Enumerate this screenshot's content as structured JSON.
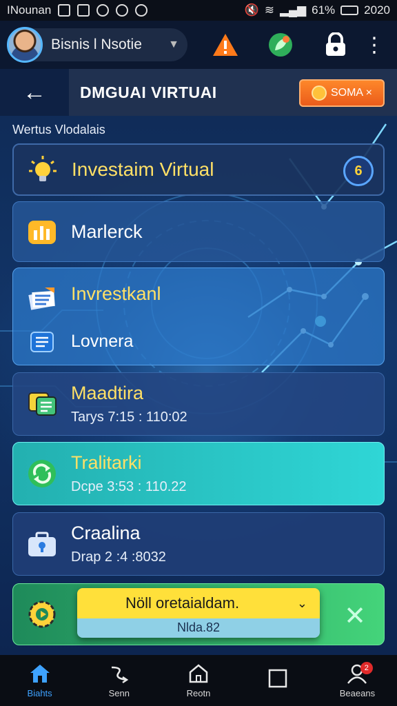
{
  "status_bar": {
    "carrier": "INounan",
    "battery": "61%",
    "time": "2020"
  },
  "app_bar": {
    "account_name": "Bisnis l Nsotie"
  },
  "header": {
    "title": "DMGUAI VIRTUAI",
    "action_label": "SOMA ×"
  },
  "section_label": "Wertus Vlodalais",
  "cards": [
    {
      "title": "Investaim Virtual",
      "badge": "6"
    },
    {
      "title": "Marlerck"
    },
    {
      "title": "Invrestkanl",
      "subtitle": "Lovnera"
    },
    {
      "title": "Maadtira",
      "subtitle": "Tarys 7:15 : 110:02"
    },
    {
      "title": "Tralitarki",
      "subtitle": "Dcpe 3:53 : 110.22"
    },
    {
      "title": "Craalina",
      "subtitle": "Drap 2 :4 :8032"
    }
  ],
  "toast": {
    "message": "Nöll oretaialdam.",
    "sub": "Nlda.82"
  },
  "nav": [
    {
      "label": "Biahts",
      "active": true
    },
    {
      "label": "Senn"
    },
    {
      "label": "Reotn"
    },
    {
      "label": ""
    },
    {
      "label": "Beaeans",
      "badge": "2"
    }
  ],
  "colors": {
    "accent": "#3ea2ff",
    "warning": "#ff7a1a",
    "highlight": "#ffe066"
  }
}
